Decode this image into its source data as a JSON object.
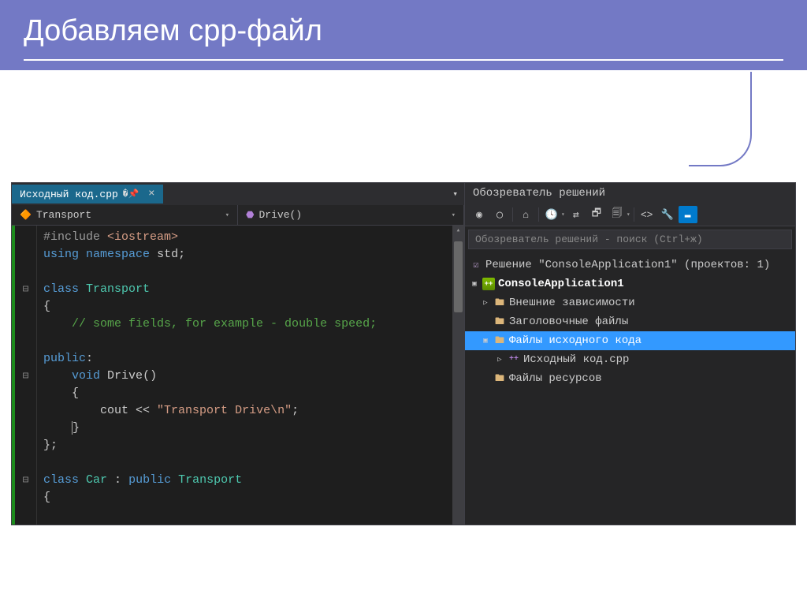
{
  "slide": {
    "title": "Добавляем cpp-файл"
  },
  "editor": {
    "tab": {
      "filename": "Исходный код.cpp"
    },
    "nav_class": "Transport",
    "nav_method": "Drive()",
    "code": {
      "l1a": "#include",
      "l1b": "<iostream>",
      "l2a": "using",
      "l2b": "namespace",
      "l2c": "std",
      "l2d": ";",
      "l4a": "class",
      "l4b": "Transport",
      "l5": "{",
      "l6": "// some fields, for example - double speed;",
      "l8a": "public",
      "l8b": ":",
      "l9a": "void",
      "l9b": "Drive",
      "l9c": "()",
      "l10": "{",
      "l11a": "cout ",
      "l11b": "<<",
      "l11c": " \"Transport Drive\\n\"",
      "l11d": ";",
      "l12": "}",
      "l13": "};",
      "l15a": "class",
      "l15b": "Car",
      "l15c": " : ",
      "l15d": "public",
      "l15e": "Transport",
      "l16": "{"
    }
  },
  "solution": {
    "pane_title": "Обозреватель решений",
    "search_placeholder": "Обозреватель решений - поиск (Ctrl+ж)",
    "tree": {
      "solution_label": "Решение \"ConsoleApplication1\" (проектов: 1)",
      "project": "ConsoleApplication1",
      "externals": "Внешние зависимости",
      "headers": "Заголовочные файлы",
      "sources": "Файлы исходного кода",
      "source_file": "Исходный код.cpp",
      "resources": "Файлы ресурсов"
    }
  }
}
